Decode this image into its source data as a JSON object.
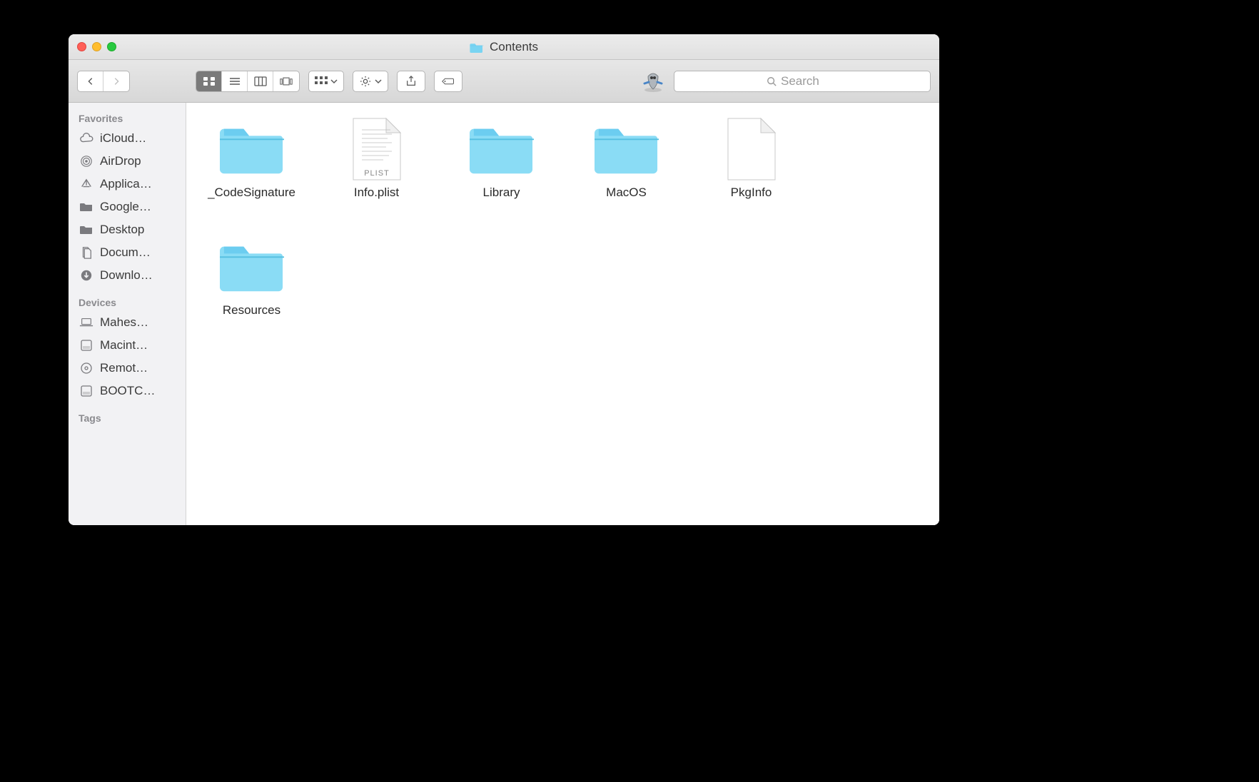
{
  "window": {
    "title": "Contents"
  },
  "toolbar": {
    "search_placeholder": "Search"
  },
  "sidebar": {
    "favorites_header": "Favorites",
    "favorites": [
      {
        "label": "iCloud…",
        "icon": "cloud"
      },
      {
        "label": "AirDrop",
        "icon": "airdrop"
      },
      {
        "label": "Applica…",
        "icon": "applications"
      },
      {
        "label": "Google…",
        "icon": "folder"
      },
      {
        "label": "Desktop",
        "icon": "folder"
      },
      {
        "label": "Docum…",
        "icon": "documents"
      },
      {
        "label": "Downlo…",
        "icon": "downloads"
      }
    ],
    "devices_header": "Devices",
    "devices": [
      {
        "label": "Mahes…",
        "icon": "laptop"
      },
      {
        "label": "Macint…",
        "icon": "disk"
      },
      {
        "label": "Remot…",
        "icon": "optical"
      },
      {
        "label": "BOOTC…",
        "icon": "disk"
      }
    ],
    "tags_header": "Tags"
  },
  "items": [
    {
      "name": "_CodeSignature",
      "kind": "folder"
    },
    {
      "name": "Info.plist",
      "kind": "plist"
    },
    {
      "name": "Library",
      "kind": "folder"
    },
    {
      "name": "MacOS",
      "kind": "folder"
    },
    {
      "name": "PkgInfo",
      "kind": "blank"
    },
    {
      "name": "Resources",
      "kind": "folder"
    }
  ]
}
